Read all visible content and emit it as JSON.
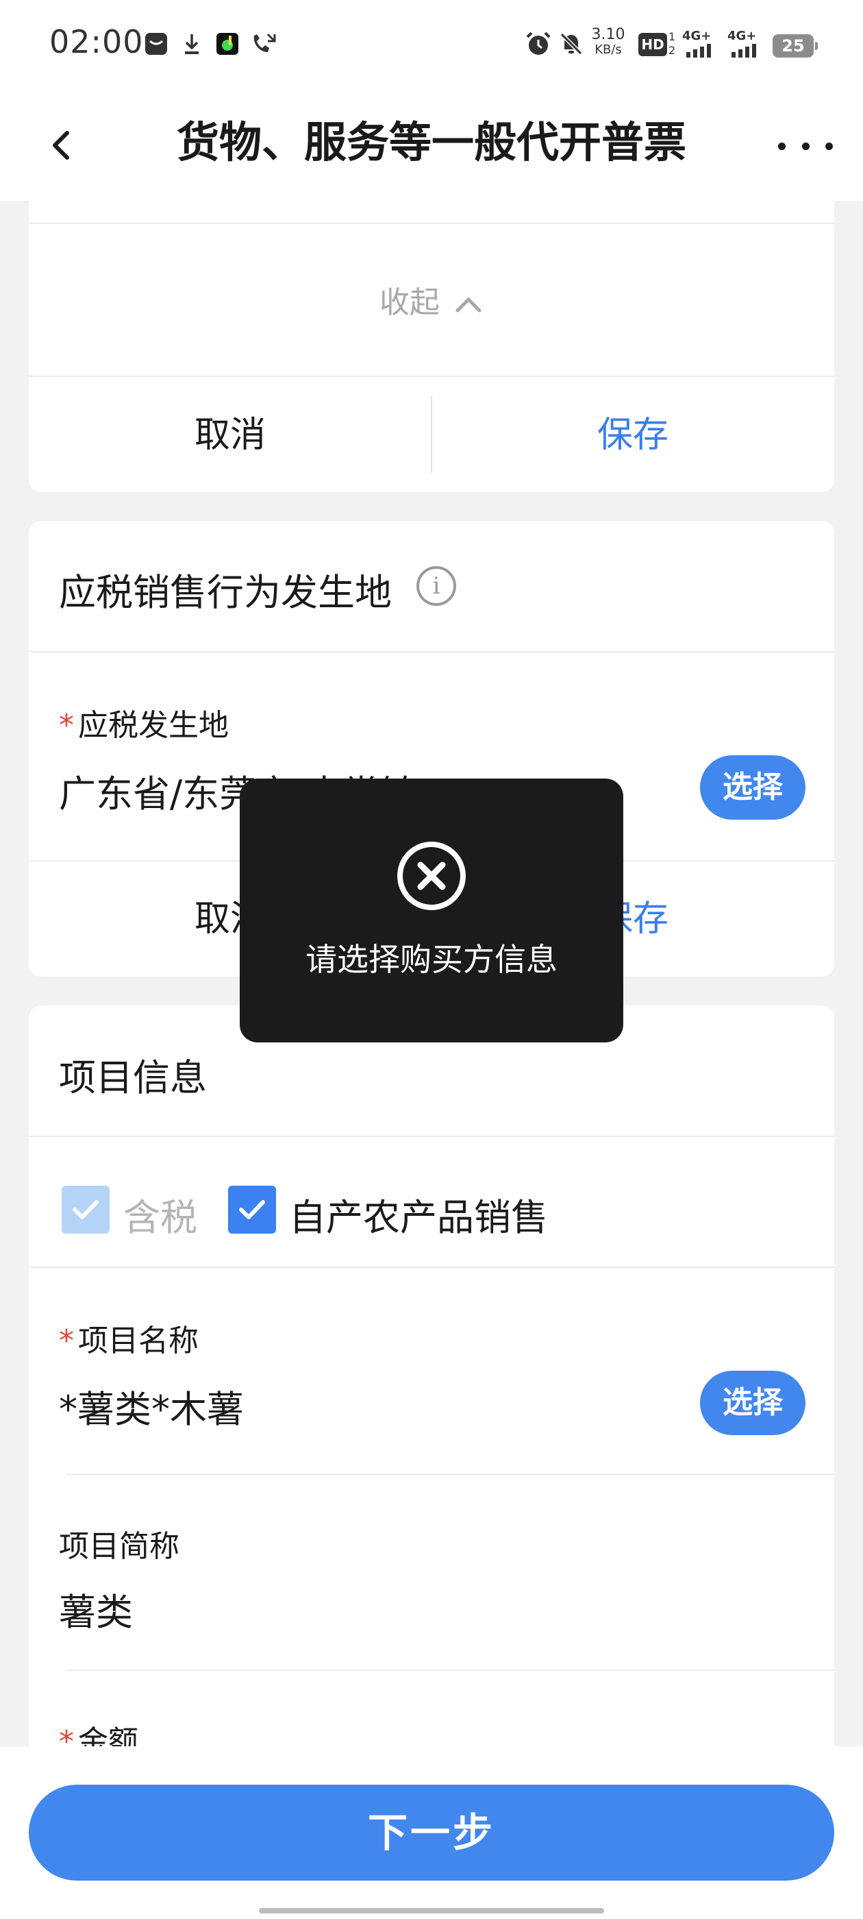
{
  "status_bar": {
    "time": "02:00",
    "net_speed_value": "3.10",
    "net_speed_unit": "KB/s",
    "hd_label": "HD",
    "signal1_label": "4G+",
    "signal2_label": "4G+",
    "battery": "25"
  },
  "nav": {
    "title": "货物、服务等一般代开普票"
  },
  "card_top": {
    "collapse_label": "收起",
    "cancel_label": "取消",
    "save_label": "保存"
  },
  "tax_location": {
    "section_title": "应税销售行为发生地",
    "info_glyph": "i",
    "field_label": "应税发生地",
    "field_value": "广东省/东莞市/中堂镇",
    "select_label": "选择",
    "cancel_label": "取消",
    "save_label": "保存"
  },
  "toast": {
    "message": "请选择购买方信息"
  },
  "project_info": {
    "section_title": "项目信息",
    "tax_included_label": "含税",
    "agri_sale_label": "自产农产品销售",
    "name_label": "项目名称",
    "name_value": "*薯类*木薯",
    "name_select_label": "选择",
    "short_name_label": "项目简称",
    "short_name_value": "薯类",
    "amount_label": "金额"
  },
  "footer": {
    "next_label": "下一步"
  },
  "colors": {
    "accent": "#4287ee",
    "required_star": "#e2463a",
    "toast_bg": "#1b1b1b"
  },
  "icons": {
    "back": "chevron-left-icon",
    "more": "more-dots-icon",
    "collapse": "chevron-up-icon",
    "info": "info-icon",
    "toast": "close-circle-icon",
    "check": "check-icon"
  }
}
